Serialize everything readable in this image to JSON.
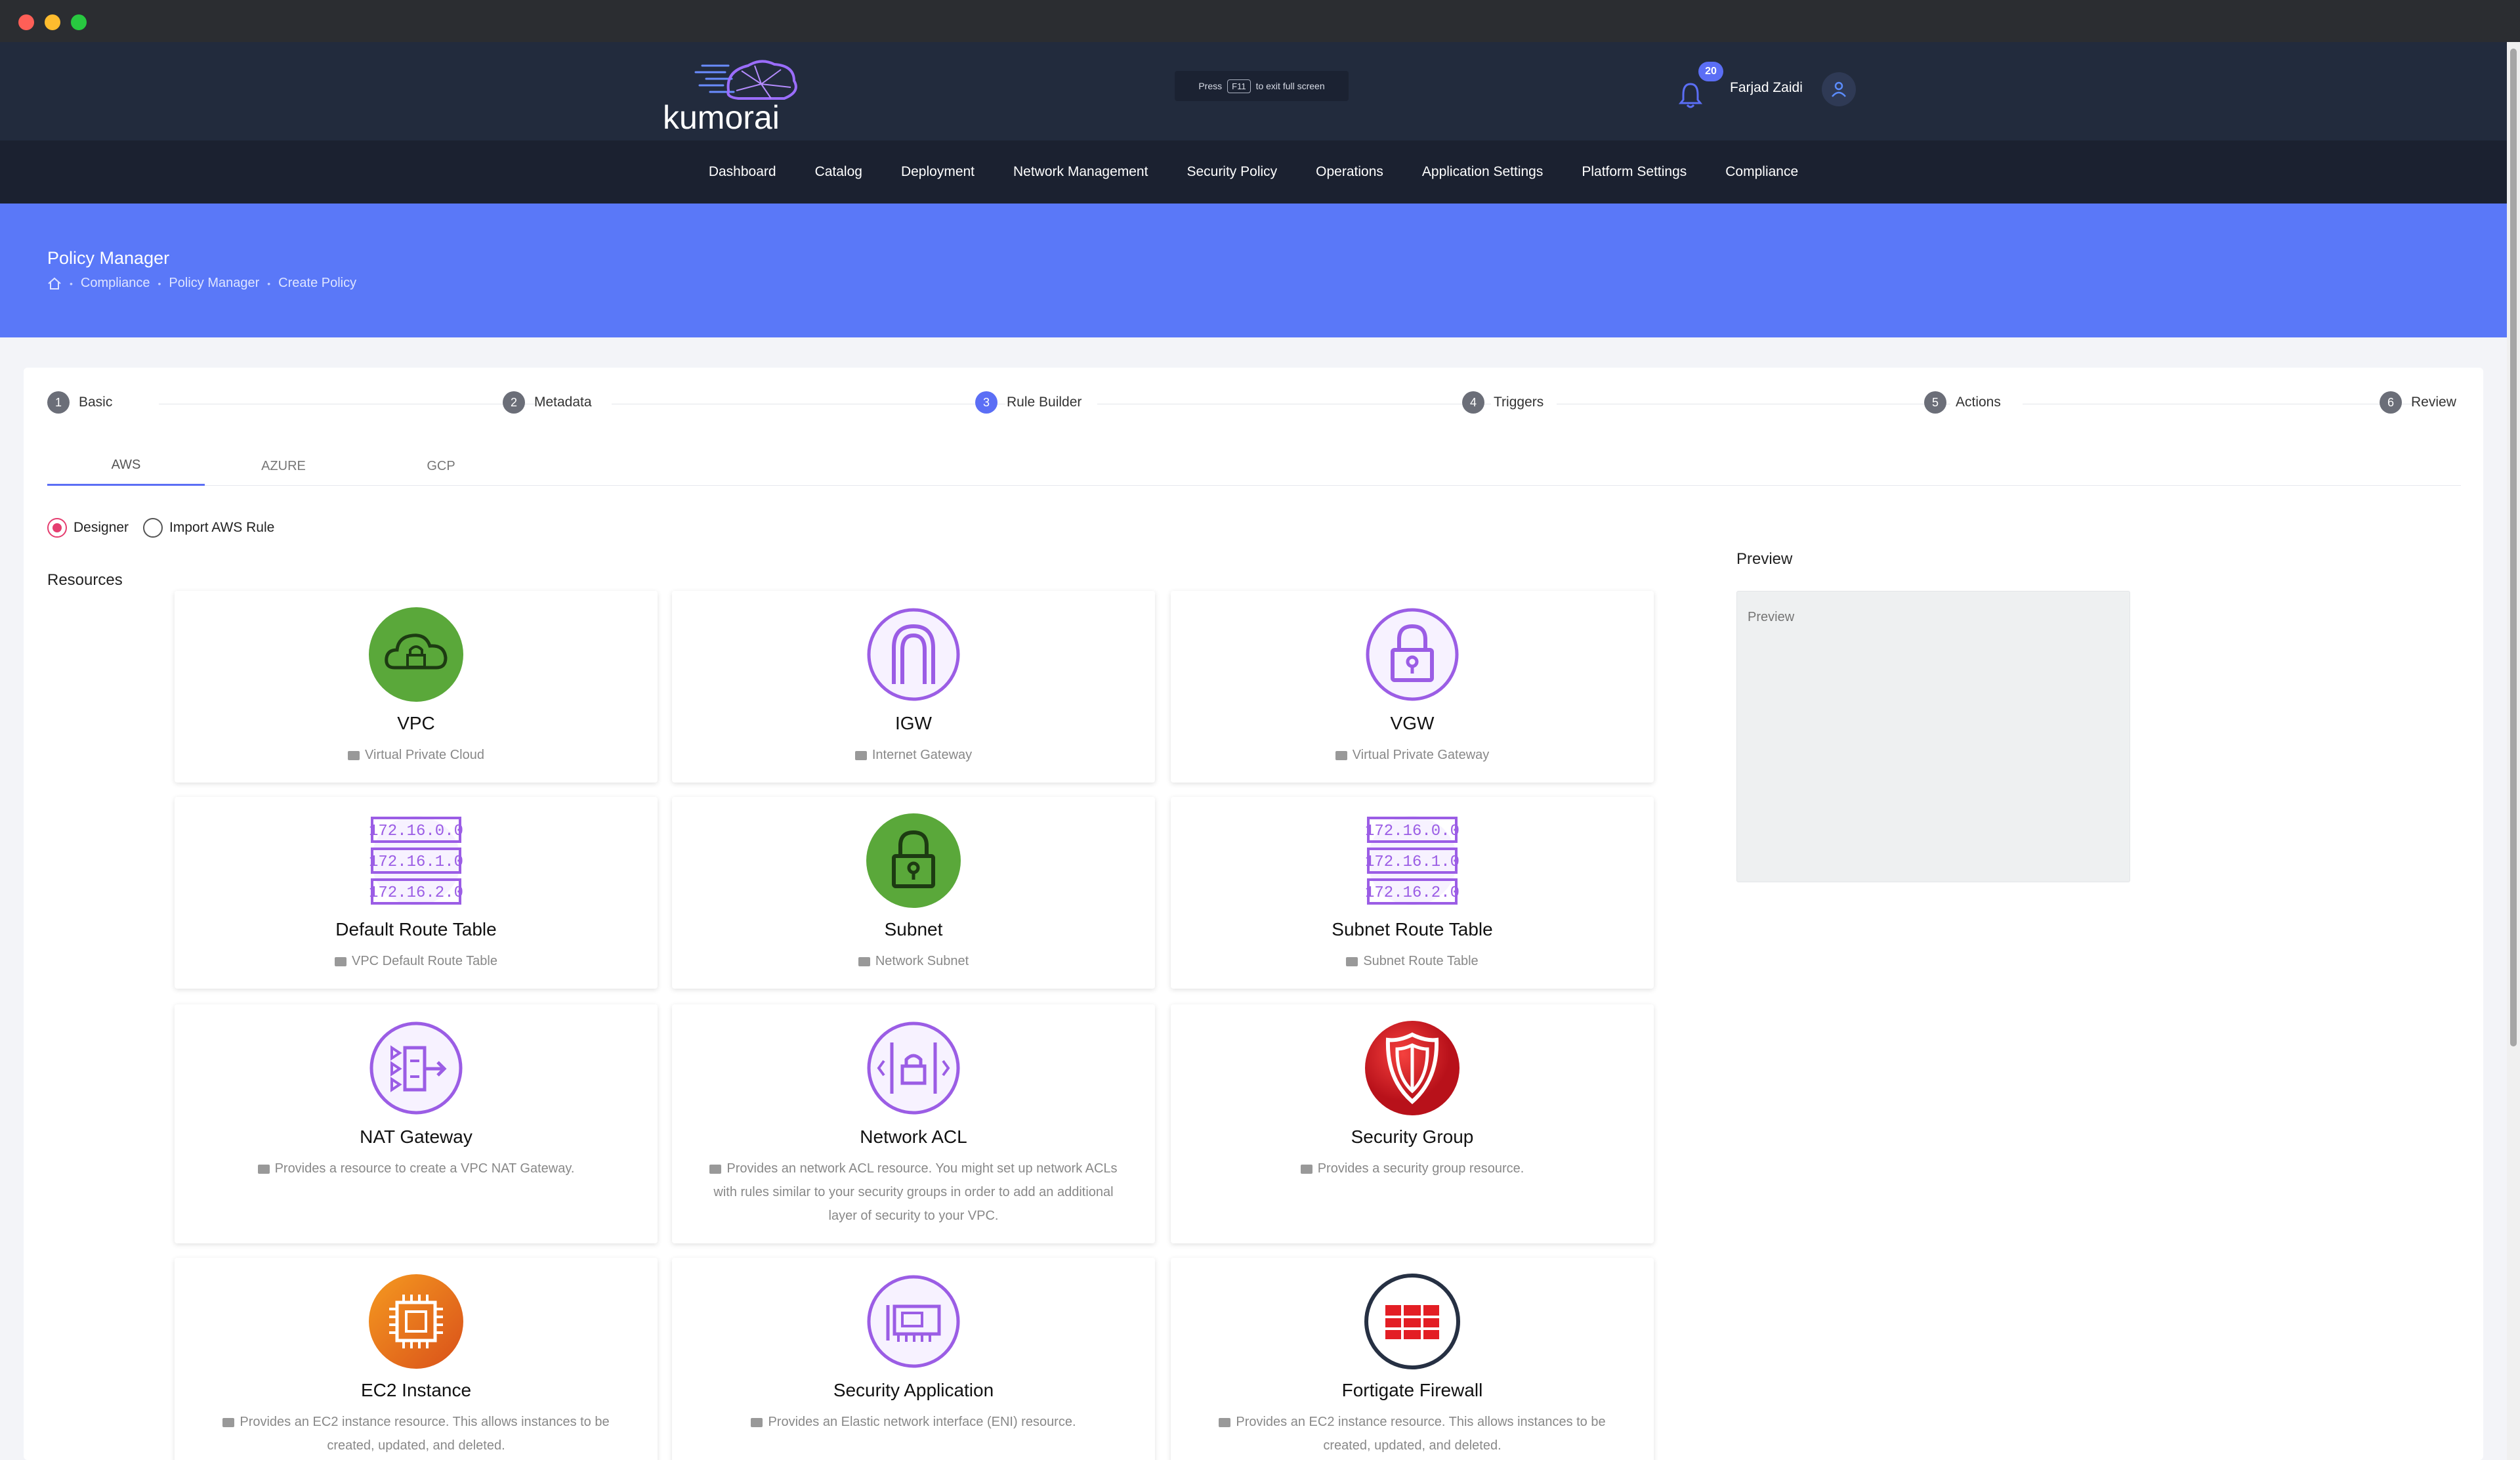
{
  "header": {
    "logo_text": "kumorai",
    "fullscreen_press": "Press",
    "fullscreen_key": "F11",
    "fullscreen_suffix": "to exit full screen",
    "notification_count": "20",
    "username": "Farjad Zaidi"
  },
  "nav": [
    "Dashboard",
    "Catalog",
    "Deployment",
    "Network Management",
    "Security Policy",
    "Operations",
    "Application Settings",
    "Platform Settings",
    "Compliance"
  ],
  "page": {
    "title": "Policy Manager",
    "breadcrumb": [
      "Compliance",
      "Policy Manager",
      "Create Policy"
    ]
  },
  "steps": [
    {
      "num": "1",
      "label": "Basic"
    },
    {
      "num": "2",
      "label": "Metadata"
    },
    {
      "num": "3",
      "label": "Rule Builder"
    },
    {
      "num": "4",
      "label": "Triggers"
    },
    {
      "num": "5",
      "label": "Actions"
    },
    {
      "num": "6",
      "label": "Review"
    }
  ],
  "active_step": 3,
  "tabs": [
    "AWS",
    "AZURE",
    "GCP"
  ],
  "active_tab": "AWS",
  "mode_options": [
    "Designer",
    "Import AWS Rule"
  ],
  "selected_mode": "Designer",
  "resources_label": "Resources",
  "preview": {
    "label": "Preview",
    "placeholder": "Preview"
  },
  "resources": [
    {
      "name": "VPC",
      "desc": "Virtual Private Cloud",
      "icon": "vpc-cloud-lock-icon"
    },
    {
      "name": "IGW",
      "desc": "Internet Gateway",
      "icon": "igw-arch-icon"
    },
    {
      "name": "VGW",
      "desc": "Virtual Private Gateway",
      "icon": "vgw-lock-icon"
    },
    {
      "name": "Default Route Table",
      "desc": "VPC Default Route Table",
      "icon": "route-table-icon"
    },
    {
      "name": "Subnet",
      "desc": "Network Subnet",
      "icon": "subnet-lock-icon"
    },
    {
      "name": "Subnet Route Table",
      "desc": "Subnet Route Table",
      "icon": "route-table-icon"
    },
    {
      "name": "NAT Gateway",
      "desc": "Provides a resource to create a VPC NAT Gateway.",
      "icon": "nat-gateway-icon"
    },
    {
      "name": "Network ACL",
      "desc": "Provides an network ACL resource. You might set up network ACLs with rules similar to your security groups in order to add an additional layer of security to your VPC.",
      "icon": "network-acl-icon"
    },
    {
      "name": "Security Group",
      "desc": "Provides a security group resource.",
      "icon": "shield-icon"
    },
    {
      "name": "EC2 Instance",
      "desc": "Provides an EC2 instance resource. This allows instances to be created, updated, and deleted.",
      "icon": "chip-icon"
    },
    {
      "name": "Security Application",
      "desc": "Provides an Elastic network interface (ENI) resource.",
      "icon": "eni-card-icon"
    },
    {
      "name": "Fortigate Firewall",
      "desc": "Provides an EC2 instance resource. This allows instances to be created, updated, and deleted.",
      "icon": "fortigate-icon"
    }
  ],
  "route_table_ips": [
    "172.16.0.0",
    "172.16.1.0",
    "172.16.2.0"
  ],
  "colors": {
    "accent": "#5b6ef5",
    "banner": "#5a78f8",
    "header": "#222b3d",
    "nav": "#1b2130",
    "radio": "#e53e70",
    "purple": "#9b5de5",
    "green": "#5aa83a"
  }
}
